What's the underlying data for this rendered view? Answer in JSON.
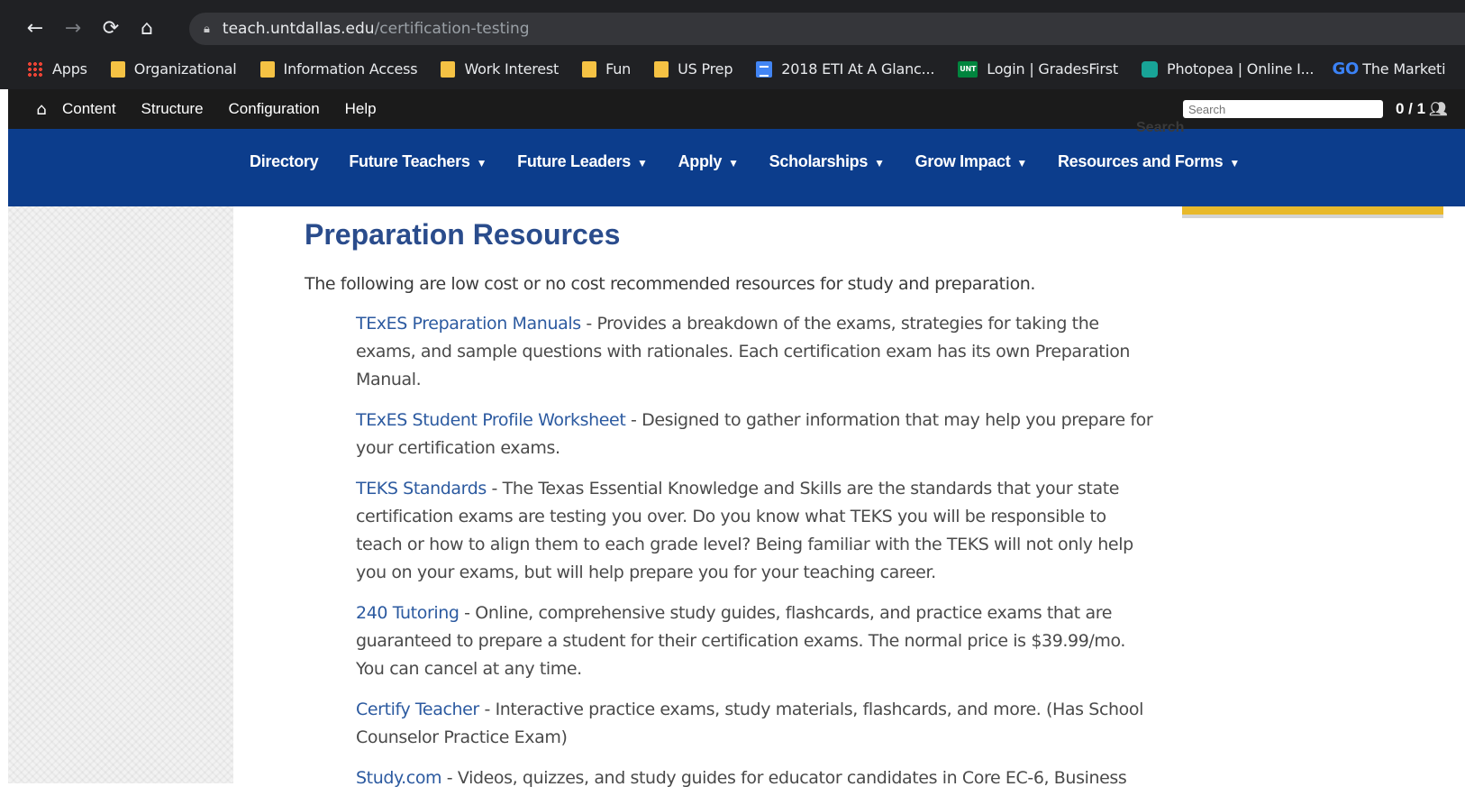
{
  "browser": {
    "url_host": "teach.untdallas.edu",
    "url_path": "/certification-testing",
    "bookmarks": [
      {
        "label": "Apps",
        "icon": "apps-grid-icon"
      },
      {
        "label": "Organizational",
        "icon": "folder-icon"
      },
      {
        "label": "Information Access",
        "icon": "folder-icon"
      },
      {
        "label": "Work Interest",
        "icon": "folder-icon"
      },
      {
        "label": "Fun",
        "icon": "folder-icon"
      },
      {
        "label": "US Prep",
        "icon": "folder-icon"
      },
      {
        "label": "2018 ETI At A Glanc...",
        "icon": "doc-icon"
      },
      {
        "label": "Login | GradesFirst",
        "icon": "unt-icon",
        "icon_text": "UNT"
      },
      {
        "label": "Photopea | Online I...",
        "icon": "photopea-icon"
      },
      {
        "label": "The Marketi",
        "icon": "go-icon",
        "icon_text": "GO"
      }
    ]
  },
  "admin_toolbar": {
    "links": [
      "Content",
      "Structure",
      "Configuration",
      "Help"
    ],
    "search_placeholder": "Search",
    "search_ghost": "Search",
    "count": "0 / 1"
  },
  "site_nav": {
    "items": [
      {
        "label": "Directory",
        "dropdown": false
      },
      {
        "label": "Future Teachers",
        "dropdown": true
      },
      {
        "label": "Future Leaders",
        "dropdown": true
      },
      {
        "label": "Apply",
        "dropdown": true
      },
      {
        "label": "Scholarships",
        "dropdown": true
      },
      {
        "label": "Grow Impact",
        "dropdown": true
      },
      {
        "label": "Resources and Forms",
        "dropdown": true
      }
    ]
  },
  "main": {
    "title": "Preparation Resources",
    "intro": "The following are low cost or no cost recommended resources for study and preparation.",
    "resources": [
      {
        "link": "TExES Preparation Manuals",
        "text": " - Provides a breakdown of the exams, strategies for taking the exams, and sample questions with rationales. Each certification exam has its own Preparation Manual."
      },
      {
        "link": "TExES Student Profile Worksheet",
        "text": " - Designed to gather information that may help you prepare for your certification exams."
      },
      {
        "link": "TEKS Standards",
        "text": " - The Texas Essential Knowledge and Skills are the standards that your state certification exams are testing you over. Do you know what TEKS you will be responsible to teach or how to align them to each grade level? Being familiar with the TEKS will not only help you on your exams, but will help prepare you for your teaching career."
      },
      {
        "link": "240 Tutoring",
        "text": " - Online, comprehensive study guides, flashcards, and practice exams that are guaranteed to prepare a student for their certification exams. The normal price is $39.99/mo. You can cancel at any time."
      },
      {
        "link": "Certify Teacher",
        "text": " - Interactive practice exams, study materials, flashcards, and more. (Has School Counselor Practice Exam)"
      },
      {
        "link": "Study.com",
        "text": " - Videos, quizzes, and study guides for educator candidates in Core EC-6, Business"
      }
    ]
  },
  "colors": {
    "nav_blue": "#0c3d8c",
    "title_blue": "#2a4c8c",
    "link_blue": "#2c5aa0",
    "accent_yellow": "#e8b92b"
  }
}
